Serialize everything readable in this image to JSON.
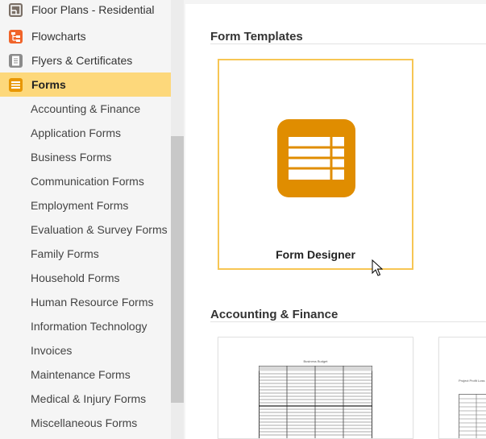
{
  "sidebar": {
    "categories": [
      {
        "label": "Floor Plans - Residential",
        "icon": "floor-plan-icon",
        "color": "#7a6f66"
      },
      {
        "label": "Flowcharts",
        "icon": "flowchart-icon",
        "color": "#f0642a"
      },
      {
        "label": "Flyers & Certificates",
        "icon": "flyer-icon",
        "color": "#8c8c8c"
      },
      {
        "label": "Forms",
        "icon": "forms-icon",
        "color": "#e89600",
        "selected": true
      }
    ],
    "subcategories": [
      "Accounting & Finance",
      "Application Forms",
      "Business Forms",
      "Communication Forms",
      "Employment Forms",
      "Evaluation & Survey Forms",
      "Family Forms",
      "Household Forms",
      "Human Resource Forms",
      "Information Technology",
      "Invoices",
      "Maintenance Forms",
      "Medical & Injury Forms",
      "Miscellaneous Forms"
    ]
  },
  "main": {
    "templates_title": "Form Templates",
    "designer_label": "Form Designer",
    "accounting_title": "Accounting & Finance",
    "thumb1_title": "Business Budget",
    "thumb2_title": "Project Profit Loss"
  },
  "colors": {
    "accent": "#e08d00",
    "selected_bg": "#fdd87b",
    "card_border": "#f7c654"
  }
}
